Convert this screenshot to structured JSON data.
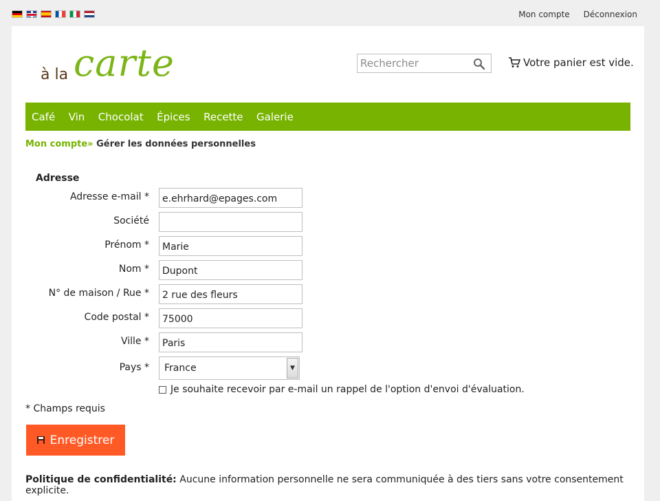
{
  "topbar": {
    "flags": [
      "German",
      "English",
      "Spanish",
      "French",
      "Italian",
      "Dutch"
    ],
    "account_link": "Mon compte",
    "logout_link": "Déconnexion"
  },
  "logo": {
    "small": "à la",
    "big": "carte"
  },
  "search": {
    "placeholder": "Rechercher"
  },
  "cart": {
    "text": "Votre panier est vide."
  },
  "nav": {
    "items": [
      {
        "label": "Café"
      },
      {
        "label": "Vin"
      },
      {
        "label": "Chocolat"
      },
      {
        "label": "Épices"
      },
      {
        "label": "Recette"
      },
      {
        "label": "Galerie"
      }
    ]
  },
  "breadcrumb": {
    "parent": "Mon compte",
    "separator": "»",
    "current": "Gérer les données personnelles"
  },
  "form": {
    "section_title": "Adresse",
    "fields": {
      "email": {
        "label": "Adresse e-mail *",
        "value": "e.ehrhard@epages.com"
      },
      "company": {
        "label": "Société",
        "value": ""
      },
      "firstname": {
        "label": "Prénom *",
        "value": "Marie"
      },
      "lastname": {
        "label": "Nom *",
        "value": "Dupont"
      },
      "street": {
        "label": "N° de maison / Rue *",
        "value": "2 rue des fleurs"
      },
      "zip": {
        "label": "Code postal *",
        "value": "75000"
      },
      "city": {
        "label": "Ville *",
        "value": "Paris"
      },
      "country": {
        "label": "Pays *",
        "value": "France"
      }
    },
    "reminder_checkbox": {
      "label": "Je souhaite recevoir par e-mail un rappel de l'option d'envoi d'évaluation.",
      "checked": false
    },
    "required_note": "* Champs requis",
    "save_label": "Enregistrer"
  },
  "privacy": {
    "title": "Politique de confidentialité:",
    "text": "Aucune information personnelle ne sera communiquée à des tiers sans votre consentement explicite."
  },
  "colors": {
    "nav_green": "#77b300",
    "brand_green": "#7cb518",
    "button_orange": "#ff5a26"
  }
}
